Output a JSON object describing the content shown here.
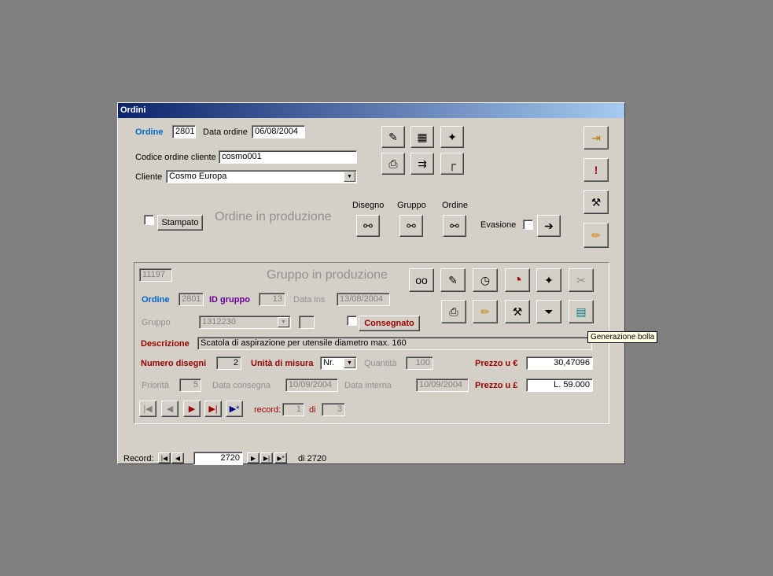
{
  "window": {
    "title": "Ordini"
  },
  "header": {
    "ordine_label": "Ordine",
    "ordine_value": "2801",
    "data_ordine_label": "Data ordine",
    "data_ordine_value": "06/08/2004",
    "codice_label": "Codice ordine cliente",
    "codice_value": "cosmo001",
    "cliente_label": "Cliente",
    "cliente_value": "Cosmo Europa",
    "stampato_label": "Stampato",
    "status_text": "Ordine in produzione",
    "disegno_label": "Disegno",
    "gruppo_label": "Gruppo",
    "ordine2_label": "Ordine",
    "evasione_label": "Evasione"
  },
  "sub": {
    "id_value": "11197",
    "status_text": "Gruppo in produzione",
    "ordine_label": "Ordine",
    "ordine_value": "2801",
    "idgruppo_label": "ID gruppo",
    "idgruppo_value": "13",
    "datains_label": "Data ins",
    "datains_value": "13/08/2004",
    "gruppo_label": "Gruppo",
    "gruppo_value": "1312230",
    "consegnato_label": "Consegnato",
    "descrizione_label": "Descrizione",
    "descrizione_value": "Scatola di aspirazione per utensile diametro max. 160",
    "numdisegni_label": "Numero disegni",
    "numdisegni_value": "2",
    "unita_label": "Unità di misura",
    "unita_value": "Nr.",
    "quantita_label": "Quantità",
    "quantita_value": "100",
    "prezzo_eur_label": "Prezzo u €",
    "prezzo_eur_value": "30,47096",
    "priorita_label": "Priorità",
    "priorita_value": "5",
    "consegna_label": "Data consegna",
    "consegna_value": "10/09/2004",
    "interna_label": "Data interna",
    "interna_value": "10/09/2004",
    "prezzo_lit_label": "Prezzo u £",
    "prezzo_lit_value": "L. 59.000",
    "record_label": "record:",
    "record_value": "1",
    "di_label": "di",
    "di_value": "3",
    "tooltip": "Generazione bolla"
  },
  "footer": {
    "record_label": "Record:",
    "record_value": "2720",
    "total_text": "di 2720"
  }
}
